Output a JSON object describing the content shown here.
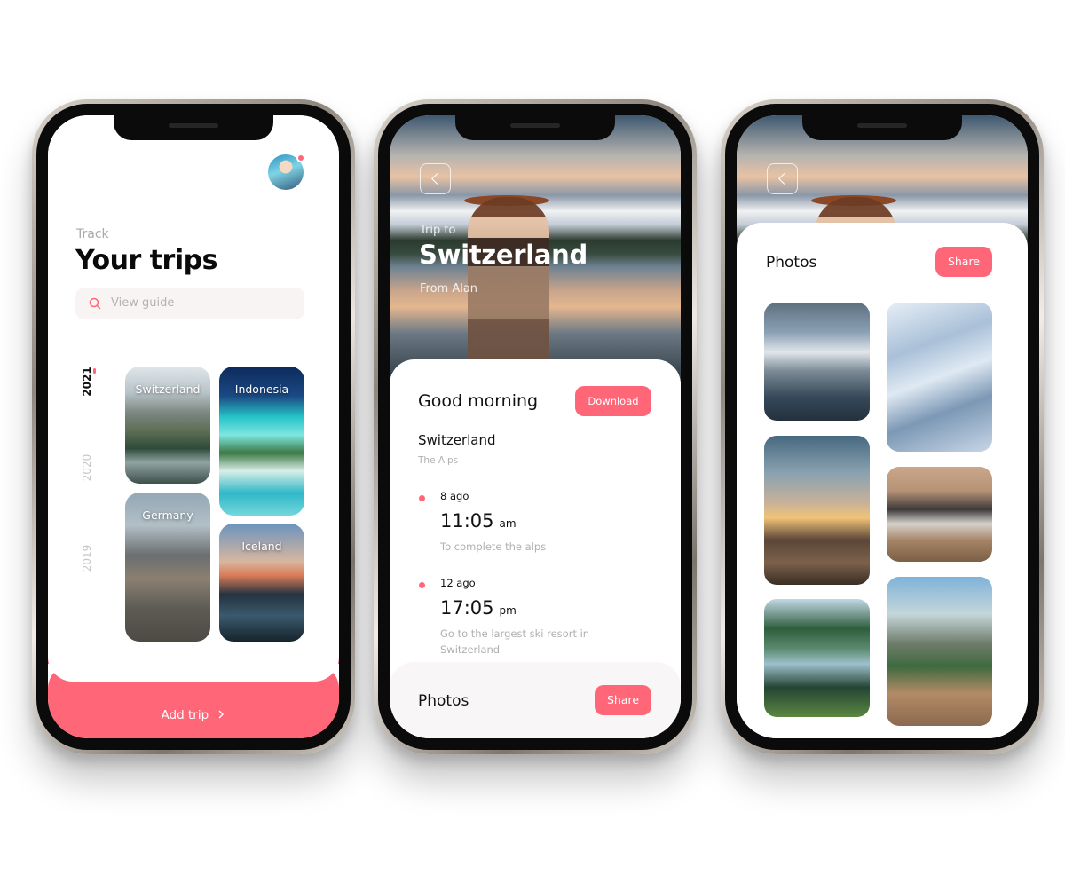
{
  "screen1": {
    "track_label": "Track",
    "title": "Your trips",
    "search": {
      "placeholder": "View guide"
    },
    "years": [
      {
        "label": "2021",
        "active": true
      },
      {
        "label": "2020",
        "active": false
      },
      {
        "label": "2019",
        "active": false
      }
    ],
    "trips": [
      {
        "name": "Switzerland"
      },
      {
        "name": "Indonesia"
      },
      {
        "name": "Germany"
      },
      {
        "name": "Iceland"
      }
    ],
    "add_trip_label": "Add trip",
    "add_trip_icon": "chevron-right-icon"
  },
  "screen2": {
    "back_icon": "chevron-left-icon",
    "trip_to": "Trip to",
    "destination": "Switzerland",
    "from": "From Alan",
    "greeting": "Good morning",
    "download_label": "Download",
    "detail_title": "Switzerland",
    "detail_subtitle": "The Alps",
    "timeline": [
      {
        "ago": "8 ago",
        "time": "11:05",
        "ampm": "am",
        "description": "To complete the alps"
      },
      {
        "ago": "12 ago",
        "time": "17:05",
        "ampm": "pm",
        "description": "Go to the largest ski resort in Switzerland"
      }
    ],
    "photos_title": "Photos",
    "share_label": "Share"
  },
  "screen3": {
    "back_icon": "chevron-left-icon",
    "photos_title": "Photos",
    "share_label": "Share"
  },
  "colors": {
    "accent": "#ff6678",
    "muted_text": "#b0b0b0",
    "search_bg": "#f8f4f4"
  }
}
